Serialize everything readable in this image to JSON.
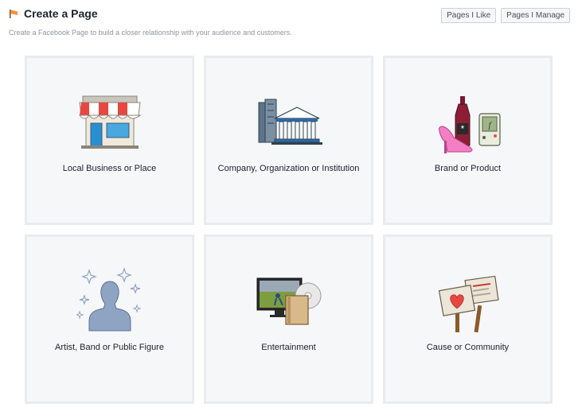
{
  "header": {
    "title": "Create a Page",
    "subtitle": "Create a Facebook Page to build a closer relationship with your audience and customers."
  },
  "buttons": {
    "pages_like": "Pages I Like",
    "pages_manage": "Pages I Manage"
  },
  "categories": [
    {
      "label": "Local Business or Place",
      "icon": "storefront-icon"
    },
    {
      "label": "Company, Organization or Institution",
      "icon": "building-institution-icon"
    },
    {
      "label": "Brand or Product",
      "icon": "brand-product-icon"
    },
    {
      "label": "Artist, Band or Public Figure",
      "icon": "person-silhouette-icon"
    },
    {
      "label": "Entertainment",
      "icon": "entertainment-media-icon"
    },
    {
      "label": "Cause or Community",
      "icon": "protest-signs-icon"
    }
  ],
  "colors": {
    "accent": "#f7923a",
    "tile_bg": "#f6f7f9",
    "tile_border": "#e9ebee"
  }
}
